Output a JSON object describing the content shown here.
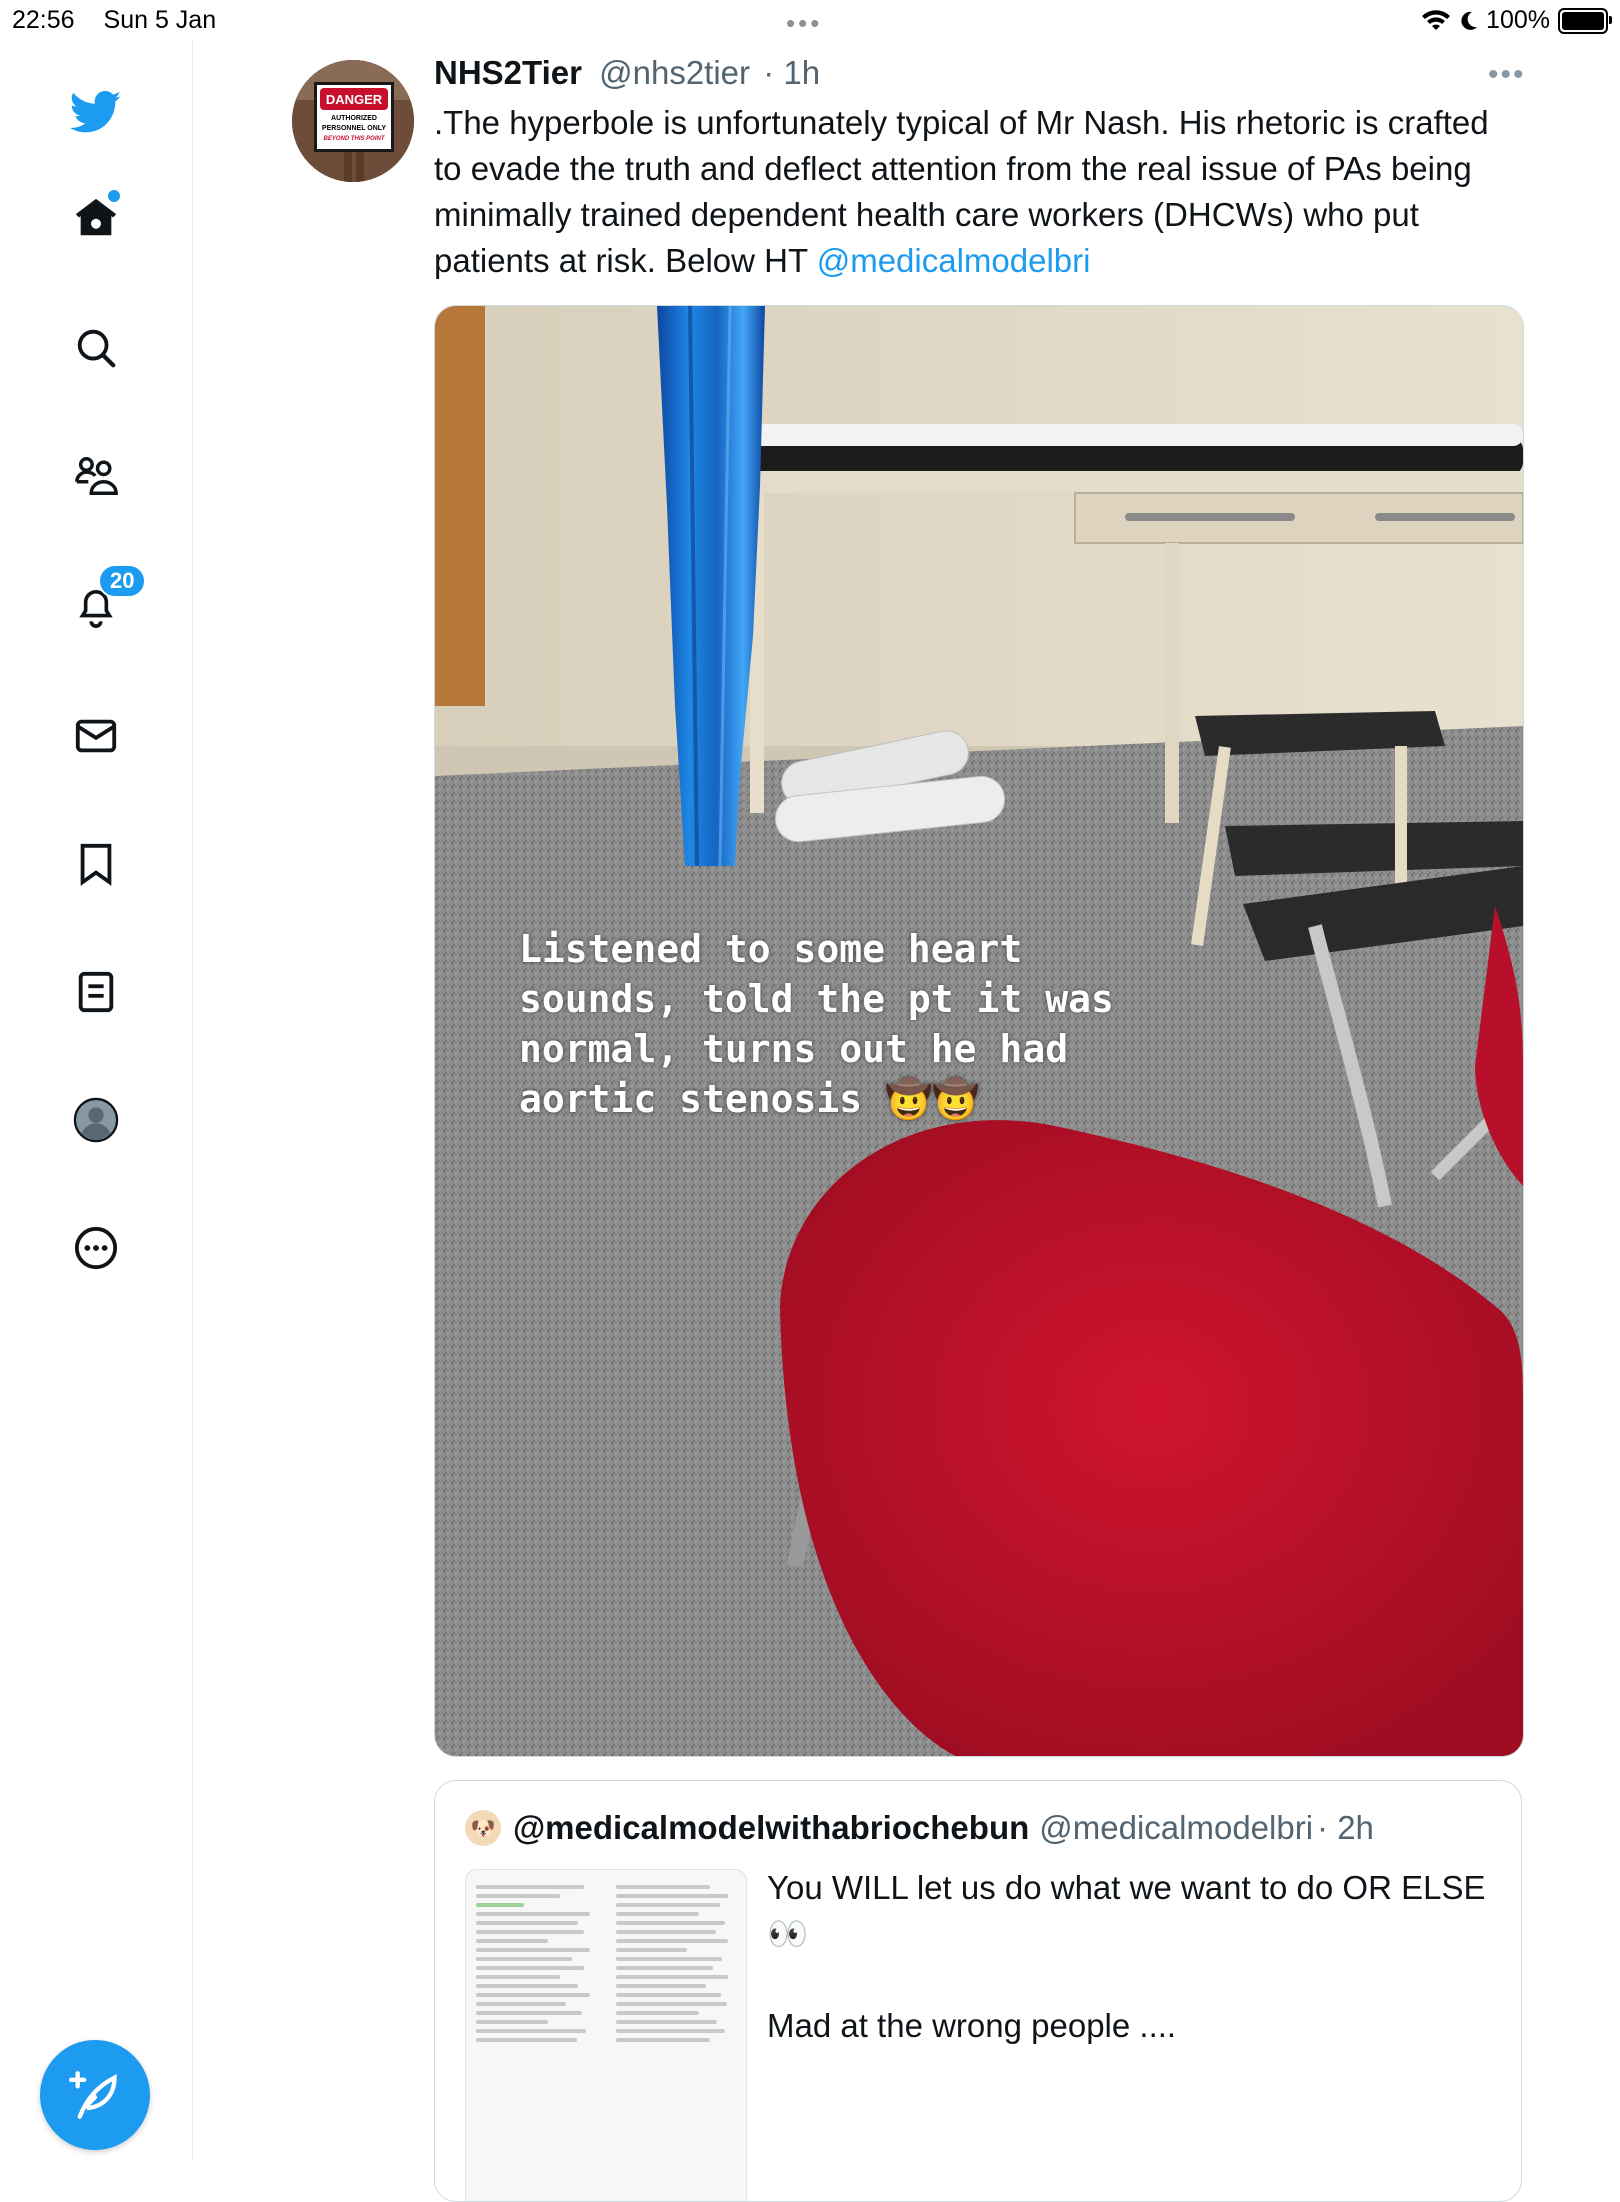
{
  "status_bar": {
    "time": "22:56",
    "date": "Sun 5 Jan",
    "battery": "100%",
    "battery_level": 1.0
  },
  "sidebar": {
    "items": [
      {
        "name": "home",
        "icon": "home-icon",
        "has_dot": true
      },
      {
        "name": "explore",
        "icon": "search-icon"
      },
      {
        "name": "communities",
        "icon": "communities-icon"
      },
      {
        "name": "notifications",
        "icon": "bell-icon",
        "badge": "20"
      },
      {
        "name": "messages",
        "icon": "envelope-icon"
      },
      {
        "name": "bookmarks",
        "icon": "bookmark-icon"
      },
      {
        "name": "lists",
        "icon": "list-icon"
      },
      {
        "name": "profile",
        "icon": "avatar-icon"
      },
      {
        "name": "more",
        "icon": "more-circle-icon"
      }
    ],
    "notifications_badge": "20"
  },
  "tweet": {
    "display_name": "NHS2Tier",
    "handle": "@nhs2tier",
    "time": "· 1h",
    "more": "•••",
    "text_before_mention": ".The hyperbole is unfortunately typical of Mr Nash. His rhetoric is crafted to evade the truth and deflect attention from the real issue of PAs being minimally trained dependent health care workers (DHCWs) who put patients at risk. Below HT ",
    "mention": "@medicalmodelbri",
    "avatar_sign": {
      "line1": "DANGER",
      "line2": "AUTHORIZED",
      "line3": "PERSONNEL ONLY",
      "line4": "BEYOND THIS POINT"
    },
    "media_caption": "Listened to some heart\nsounds, told the pt it was\nnormal, turns out he had\naortic stenosis 🤠🤠"
  },
  "quoted_tweet": {
    "display_name": "@medicalmodelwithabriochebun",
    "handle": "@medicalmodelbri",
    "time": "· 2h",
    "text_line1": "You WILL let us do what we want to do OR ELSE 👀",
    "text_line2": "Mad at the wrong people ...."
  },
  "colors": {
    "accent": "#1d9bf0",
    "text": "#0f1419",
    "muted": "#536471",
    "chair_red": "#c8102e",
    "curtain_blue": "#1565c0"
  }
}
